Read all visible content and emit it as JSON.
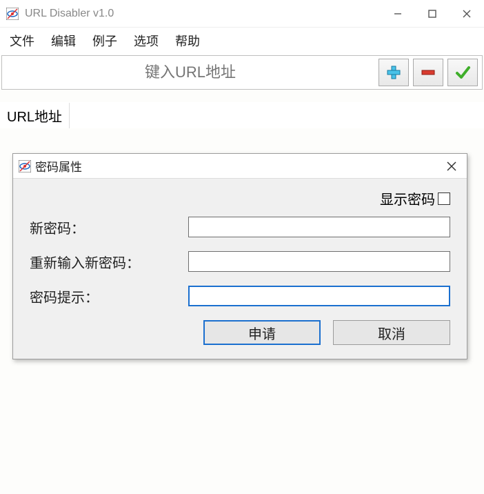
{
  "window": {
    "title": "URL Disabler v1.0"
  },
  "menu": {
    "file": "文件",
    "edit": "编辑",
    "examples": "例子",
    "options": "选项",
    "help": "帮助"
  },
  "toolbar": {
    "url_placeholder": "键入URL地址",
    "url_value": ""
  },
  "list": {
    "column_header": "URL地址"
  },
  "dialog": {
    "title": "密码属性",
    "show_password_label": "显示密码",
    "show_password_checked": false,
    "new_password_label": "新密码：",
    "new_password_value": "",
    "reenter_label": "重新输入新密码：",
    "reenter_value": "",
    "hint_label": "密码提示：",
    "hint_value": "",
    "apply_label": "申请",
    "cancel_label": "取消"
  }
}
